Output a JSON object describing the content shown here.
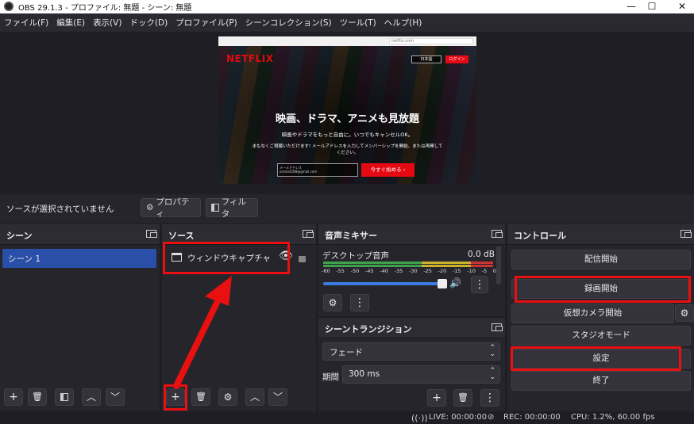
{
  "window": {
    "title": "OBS 29.1.3 - プロファイル: 無題 - シーン: 無題",
    "min": "—",
    "max": "☐",
    "close": "✕"
  },
  "menu": [
    "ファイル(F)",
    "編集(E)",
    "表示(V)",
    "ドック(D)",
    "プロファイル(P)",
    "シーンコレクション(S)",
    "ツール(T)",
    "ヘルプ(H)"
  ],
  "preview": {
    "logo": "NETFLIX",
    "url": "netflix.com",
    "lang": "日本語",
    "login": "ログイン",
    "headline": "映画、ドラマ、アニメも見放題",
    "sub1": "映画やドラマをもっと自由に。いつでもキャンセルOK。",
    "sub2": "まもなくご視聴いただけます! メールアドレスを入力してメンバーシップを開始、または再開してください。",
    "email_label": "メールアドレス",
    "email_value": "ocean4288@gmail.com",
    "cta": "今すぐ始める ›"
  },
  "source_bar": {
    "no_selection": "ソースが選択されていません",
    "properties": "プロパティ",
    "filters": "フィルタ"
  },
  "scenes": {
    "title": "シーン",
    "items": [
      "シーン 1"
    ]
  },
  "sources": {
    "title": "ソース",
    "items": [
      "ウィンドウキャプチャ"
    ]
  },
  "mixer": {
    "title": "音声ミキサー",
    "channel": "デスクトップ音声",
    "level": "0.0 dB",
    "ticks": [
      "-60",
      "-55",
      "-50",
      "-45",
      "-40",
      "-35",
      "-30",
      "-25",
      "-20",
      "-15",
      "-10",
      "-5",
      "0"
    ],
    "volume": 0.98
  },
  "transitions": {
    "title": "シーントランジション",
    "type": "フェード",
    "duration_label": "期間",
    "duration": "300 ms"
  },
  "controls": {
    "title": "コントロール",
    "buttons": [
      "配信開始",
      "録画開始",
      "仮想カメラ開始",
      "スタジオモード",
      "設定",
      "終了"
    ]
  },
  "status": {
    "live": "LIVE: 00:00:00",
    "rec": "REC: 00:00:00",
    "cpu": "CPU: 1.2%, 60.00 fps"
  },
  "colors": {
    "highlight": "#e81010",
    "selection": "#2a4fa8",
    "meter_green": "#3fa34d",
    "meter_yellow": "#c9b22a",
    "meter_red": "#c33",
    "slider": "#3d7be0"
  }
}
